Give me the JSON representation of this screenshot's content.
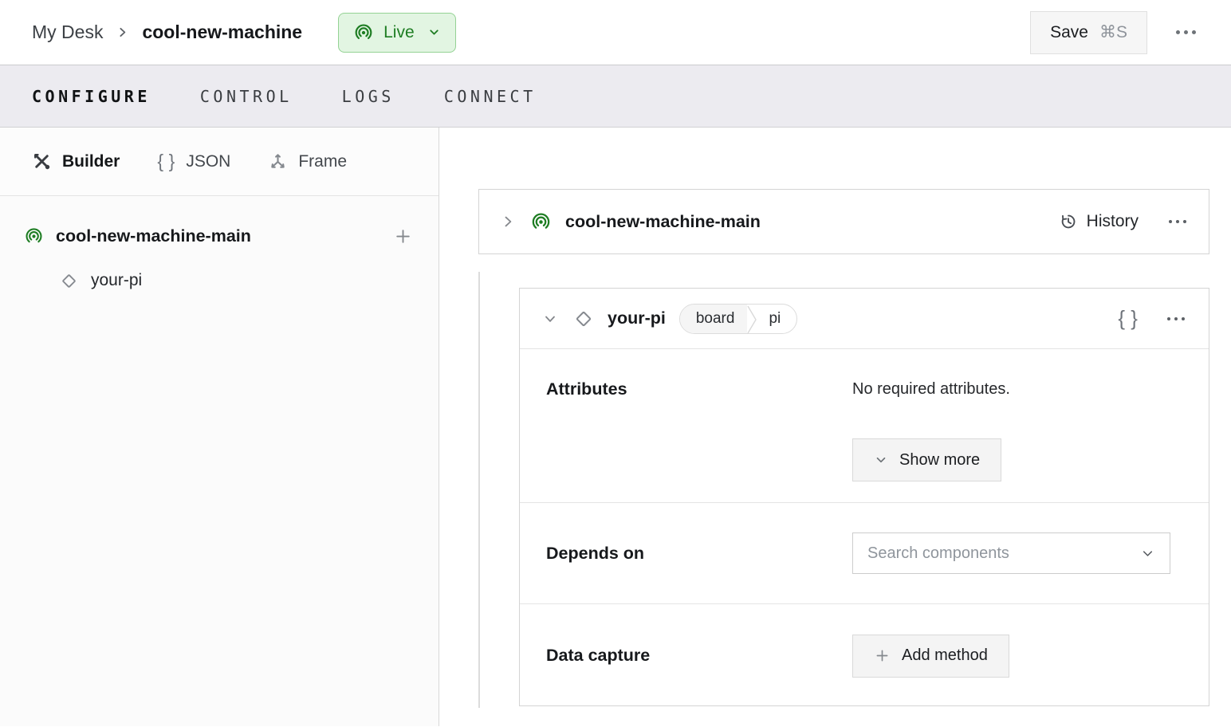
{
  "header": {
    "breadcrumb": {
      "parent": "My Desk",
      "current": "cool-new-machine"
    },
    "live_badge": {
      "label": "Live"
    },
    "save_button": {
      "label": "Save",
      "shortcut": "⌘S"
    }
  },
  "nav_tabs": [
    {
      "label": "CONFIGURE",
      "active": true
    },
    {
      "label": "CONTROL",
      "active": false
    },
    {
      "label": "LOGS",
      "active": false
    },
    {
      "label": "CONNECT",
      "active": false
    }
  ],
  "sidebar": {
    "mode_tabs": [
      {
        "label": "Builder",
        "icon": "tools-icon",
        "active": true
      },
      {
        "label": "JSON",
        "icon": "braces-icon",
        "active": false
      },
      {
        "label": "Frame",
        "icon": "frame-axes-icon",
        "active": false
      }
    ],
    "tree": {
      "machine": {
        "label": "cool-new-machine-main",
        "icon": "live-broadcast-icon",
        "add_label": "+"
      },
      "part": {
        "label": "your-pi",
        "icon": "diamond-icon"
      }
    }
  },
  "main": {
    "machine_card": {
      "title": "cool-new-machine-main",
      "history_label": "History"
    },
    "component_card": {
      "title": "your-pi",
      "badge": {
        "type": "board",
        "model": "pi"
      },
      "attributes": {
        "label": "Attributes",
        "empty_text": "No required attributes.",
        "show_more_label": "Show more"
      },
      "depends_on": {
        "label": "Depends on",
        "search_placeholder": "Search components"
      },
      "data_capture": {
        "label": "Data capture",
        "add_method_label": "Add method"
      }
    }
  },
  "icons": {
    "live-broadcast-icon": "concentric arcs with center dot",
    "tools-icon": "crossed wrench and screwdriver",
    "braces-icon": "{}",
    "frame-axes-icon": "three-axis gizmo",
    "history-icon": "clock with counterclockwise arrow",
    "diamond-icon": "outlined rotated square",
    "more-icon": "•••",
    "chevron-down-icon": "v",
    "chevron-right-icon": ">",
    "plus-icon": "+"
  },
  "colors": {
    "live_bg": "#e2f5e2",
    "live_border": "#94d294",
    "live_text": "#1e7d23",
    "broadcast_green": "#1e7d23",
    "navtabs_bg": "#ecebf0",
    "sidebar_bg": "#fbfbfb",
    "card_border": "#d4d4d4",
    "divider": "#e4e4e4",
    "button_bg": "#f4f4f4",
    "placeholder_text": "#8f959c"
  }
}
